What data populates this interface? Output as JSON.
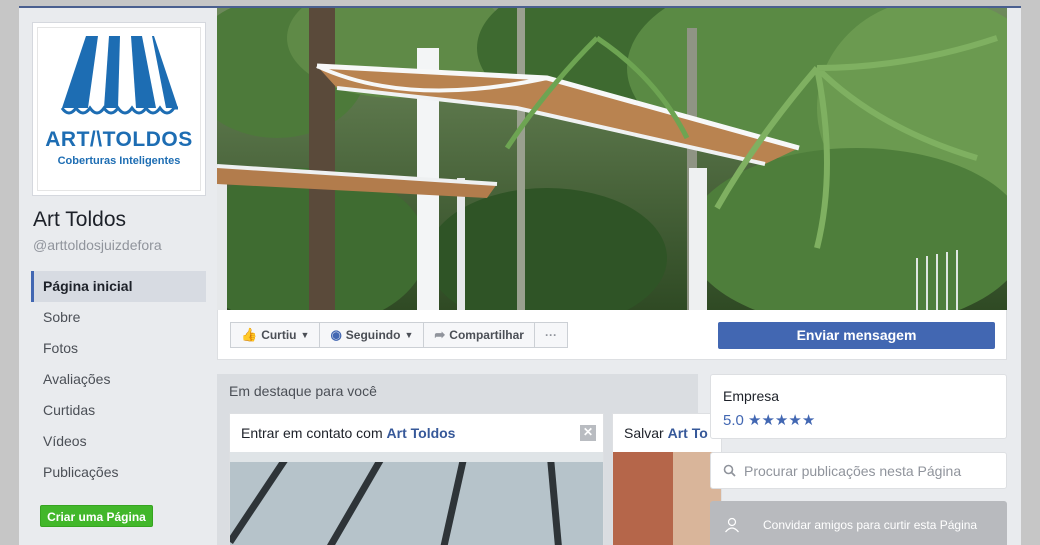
{
  "page": {
    "name": "Art Toldos",
    "handle": "@arttoldosjuizdefora",
    "logo_text": "ART/\\TOLDOS",
    "logo_subtitle": "Coberturas Inteligentes"
  },
  "nav": [
    {
      "label": "Página inicial",
      "active": true
    },
    {
      "label": "Sobre"
    },
    {
      "label": "Fotos"
    },
    {
      "label": "Avaliações"
    },
    {
      "label": "Curtidas"
    },
    {
      "label": "Vídeos"
    },
    {
      "label": "Publicações"
    }
  ],
  "create_page_label": "Criar uma Página",
  "actions": {
    "like": "Curtiu",
    "following": "Seguindo",
    "share": "Compartilhar",
    "more": "···",
    "message": "Enviar mensagem"
  },
  "featured": {
    "title": "Em destaque para você",
    "card1_prefix": "Entrar em contato com",
    "card1_name": "Art Toldos",
    "card1_close": "✕",
    "card2_prefix": "Salvar",
    "card2_name": "Art To"
  },
  "sidebar_right": {
    "category": "Empresa",
    "rating": "5.0",
    "stars": "★★★★★",
    "search_placeholder": "Procurar publicações nesta Página",
    "invite": "Convidar amigos para curtir esta Página"
  },
  "colors": {
    "brand_blue": "#4267b2",
    "link_blue": "#365899",
    "green": "#42b72a",
    "logo_blue": "#1d6db3"
  }
}
